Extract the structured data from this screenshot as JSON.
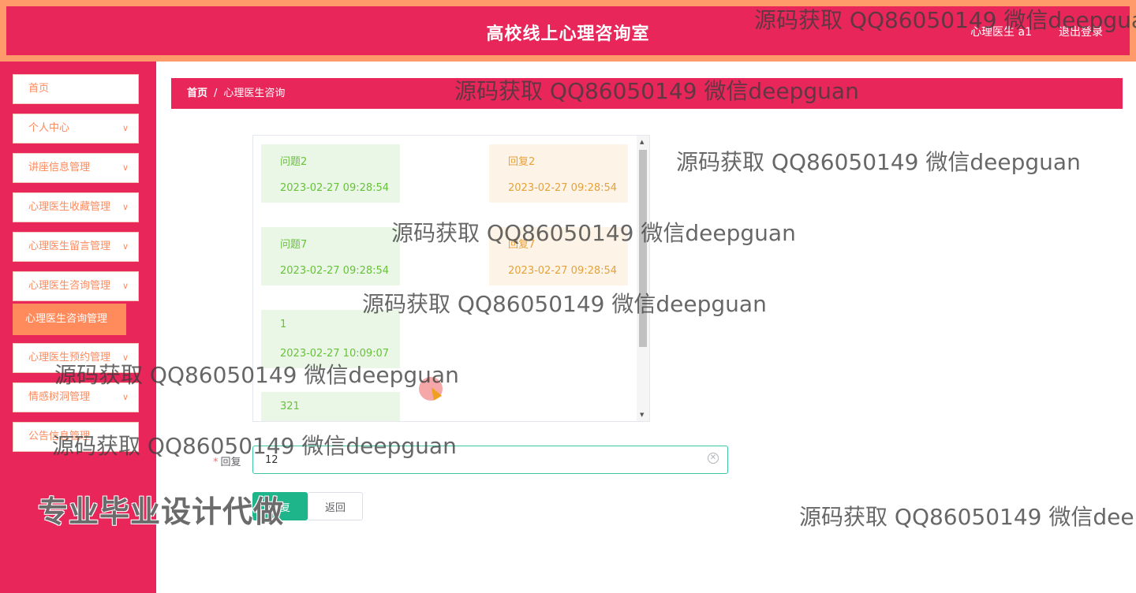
{
  "header": {
    "title": "高校线上心理咨询室",
    "user": "心理医生 a1",
    "logout": "退出登录"
  },
  "sidebar": {
    "items": [
      {
        "label": "首页",
        "has_chevron": false
      },
      {
        "label": "个人中心",
        "has_chevron": true
      },
      {
        "label": "讲座信息管理",
        "has_chevron": true
      },
      {
        "label": "心理医生收藏管理",
        "has_chevron": true
      },
      {
        "label": "心理医生留言管理",
        "has_chevron": true
      },
      {
        "label": "心理医生咨询管理",
        "has_chevron": true
      },
      {
        "label": "心理医生预约管理",
        "has_chevron": true
      },
      {
        "label": "情感树洞管理",
        "has_chevron": true
      },
      {
        "label": "公告信息管理",
        "has_chevron": false
      }
    ],
    "submenu_active": "心理医生咨询管理"
  },
  "breadcrumb": {
    "home": "首页",
    "separator": "/",
    "current": "心理医生咨询"
  },
  "chat": {
    "messages": [
      {
        "question": "问题2",
        "q_time": "2023-02-27 09:28:54",
        "reply": "回复2",
        "r_time": "2023-02-27 09:28:54"
      },
      {
        "question": "问题7",
        "q_time": "2023-02-27 09:28:54",
        "reply": "回复7",
        "r_time": "2023-02-27 09:28:54"
      },
      {
        "question": "1",
        "q_time": "2023-02-27 10:09:07"
      },
      {
        "question": "321"
      }
    ]
  },
  "form": {
    "label": "回复",
    "required_mark": "*",
    "value": "12",
    "submit": "回复",
    "back": "返回"
  },
  "watermark": "源码获取 QQ86050149 微信deepguan",
  "promo": "专业毕业设计代做",
  "colors": {
    "primary": "#e8265a",
    "accent": "#ff8a5c",
    "question_bg": "#eaf7e6",
    "reply_bg": "#fdf3e6",
    "submit": "#1fb58a"
  }
}
